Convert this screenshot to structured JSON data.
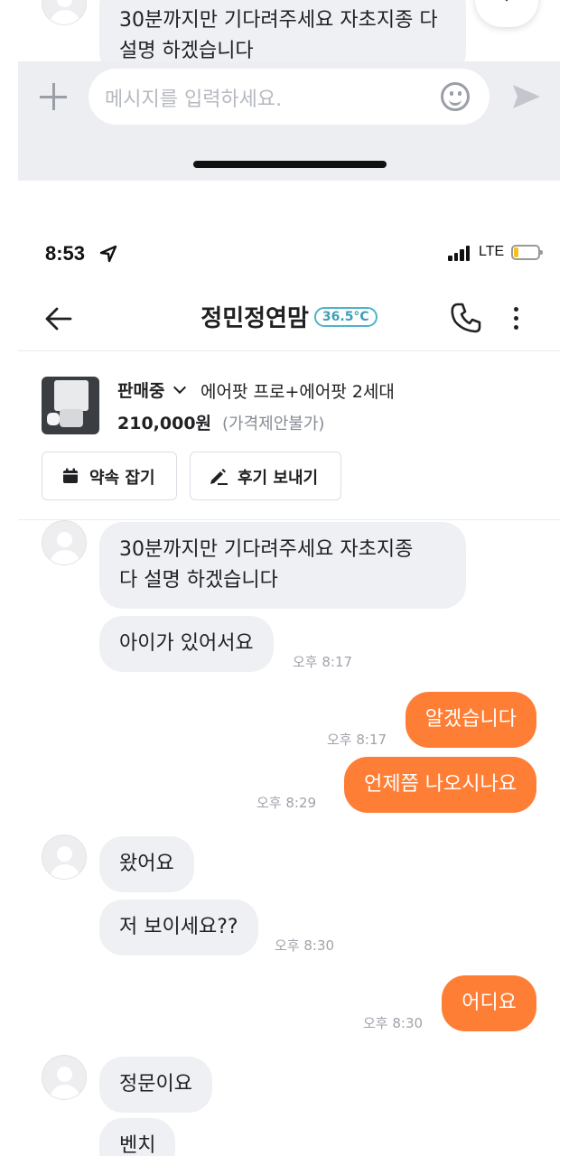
{
  "previous_screen": {
    "message_text": "30분까지만 기다려주세요 자초지종 다 설명 하겠습니다",
    "input_placeholder": "메시지를 입력하세요.",
    "icons": [
      "plus-icon",
      "emoji-icon",
      "send-icon",
      "scroll-down-icon"
    ]
  },
  "status_bar": {
    "time": "8:53",
    "network": "LTE",
    "battery_level": 0.2,
    "colors": {
      "battery": "#f5c11b"
    }
  },
  "header": {
    "title": "정민정연맘",
    "manner_temperature": "36.5°C",
    "icons": [
      "back-arrow-icon",
      "phone-icon",
      "more-vertical-icon"
    ]
  },
  "product": {
    "status": "판매중",
    "name": "에어팟 프로+에어팟 2세대",
    "price": "210,000원",
    "price_note": "(가격제안불가)",
    "buttons": {
      "promise": "약속 잡기",
      "review": "후기 보내기"
    }
  },
  "messages": [
    {
      "side": "in",
      "text": "30분까지만 기다려주세요 자초지종\n다 설명 하겠습니다",
      "time": ""
    },
    {
      "side": "in",
      "text": "아이가 있어서요",
      "time": "오후 8:17"
    },
    {
      "side": "out",
      "text": "알겠습니다",
      "time": "오후 8:17"
    },
    {
      "side": "out",
      "text": "언제쯤 나오시나요",
      "time": "오후 8:29"
    },
    {
      "side": "in",
      "text": "왔어요",
      "time": ""
    },
    {
      "side": "in",
      "text": "저 보이세요??",
      "time": "오후 8:30"
    },
    {
      "side": "out",
      "text": "어디요",
      "time": "오후 8:30"
    },
    {
      "side": "in",
      "text": "정문이요",
      "time": ""
    },
    {
      "side": "in",
      "text": "벤치",
      "time": ""
    }
  ],
  "colors": {
    "accent": "#ff7e36",
    "incoming_bubble": "#eef0f3",
    "temperature": "#3b9fb6",
    "timestamp": "#9fa3aa"
  }
}
